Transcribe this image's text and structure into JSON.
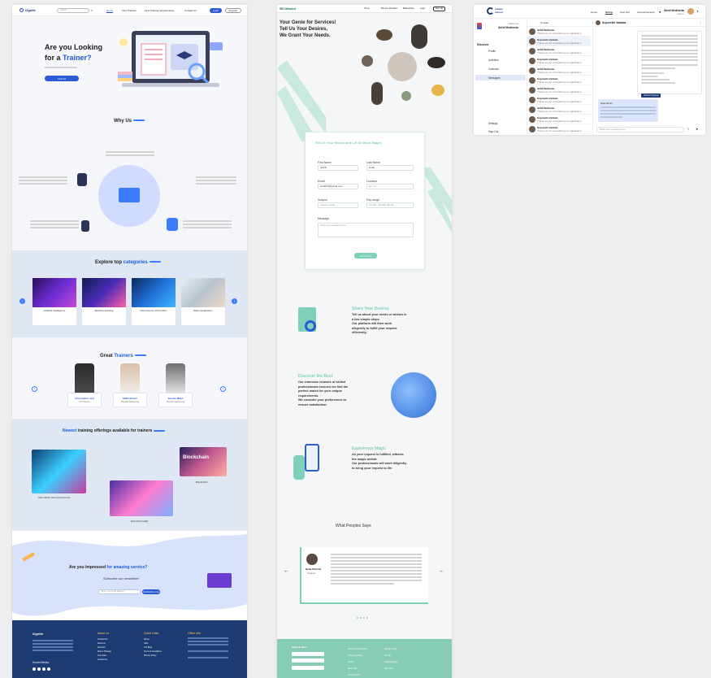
{
  "s1": {
    "header": {
      "logo": "i2gnite",
      "search_placeholder": "Search",
      "nav": [
        "Home",
        "Find Trainers",
        "Find Training Opportunities",
        "Contact Us"
      ],
      "login": "Login",
      "register": "Register"
    },
    "hero": {
      "title_a": "Are you Looking",
      "title_b": "for a ",
      "title_c": "Trainer?",
      "cta": "Find All"
    },
    "why": {
      "title": "Why Us"
    },
    "categories": {
      "title_a": "Explore top ",
      "title_b": "categories",
      "items": [
        {
          "name": "Artificial Intelligence"
        },
        {
          "name": "Machine learning"
        },
        {
          "name": "Data science Information"
        },
        {
          "name": "Data visualization"
        }
      ]
    },
    "trainers": {
      "title_a": "Great ",
      "title_b": "Trainers",
      "items": [
        {
          "name": "Christopher Jest",
          "role": "UI Trainer"
        },
        {
          "name": "Millie Brown",
          "role": "Digital Marketing"
        },
        {
          "name": "Brooke Milan",
          "role": "Digital Marketing"
        }
      ]
    },
    "offerings": {
      "title_a": "Newest",
      "title_b": " training offerings available for trainers",
      "items": [
        "Information and cybersecurity",
        "Blockchain",
        "Extended reality"
      ],
      "blockchain_image_text": "Blockchain"
    },
    "newsletter": {
      "title_a": "Are you Impressed ",
      "title_b": "for amazing service?",
      "subtitle": "Subscribe our newsletter",
      "placeholder": "Enter your email address",
      "button": "Subscribe now"
    },
    "footer": {
      "logo": "i2gnite",
      "about_title": "About us",
      "about_items": [
        "Contact Us",
        "About us",
        "Services",
        "Post a Training",
        "Our Team",
        "Contact Us"
      ],
      "quick_title": "Quick Links",
      "quick_items": [
        "Home",
        "Jobs",
        "Our Blog",
        "Terms & Conditions",
        "Privacy Policy"
      ],
      "office_title": "Office Info",
      "social": "Social Media"
    }
  },
  "s2": {
    "header": {
      "logo": "WiCitMarket",
      "nav": [
        "Home",
        "Become Providers",
        "Marketplace",
        "Login"
      ],
      "signup": "Sign Up"
    },
    "hero": {
      "line1": "Your Genie for Services!",
      "line2": "Tell Us Your Desires,",
      "line3": "We Grant Your Needs."
    },
    "form": {
      "title": "Tell Us Your Needs and Let Us Work Magic!",
      "first_name": {
        "label": "First Name",
        "value": "Aishik"
      },
      "last_name": {
        "label": "Last Name",
        "value": "Dutta"
      },
      "email": {
        "label": "Email",
        "value": "aishik01@gmail.com"
      },
      "location": {
        "label": "Location",
        "value": "Ex: xxx"
      },
      "subject": {
        "label": "Subject",
        "value": "Select a Goal"
      },
      "pay_range": {
        "label": "Pay range",
        "value": "10,000 - 20,000 /Month"
      },
      "message": {
        "label": "Message",
        "placeholder": "Write your request here..."
      },
      "submit": "Send Now"
    },
    "features": [
      {
        "title": "Share Your Desires",
        "body": [
          "Tell us about your needs or wishes in",
          "a few simple steps.",
          "Our platform will then work",
          "diligently to fulfill your request",
          "efficiently."
        ]
      },
      {
        "title": "Discover the Best",
        "body": [
          "Our extensive network of skilled",
          "professionals ensures we find the",
          "perfect match for your unique",
          "requirements.",
          "We consider your preferences to",
          "ensure satisfaction."
        ]
      },
      {
        "title": "Experience Magic",
        "body": [
          "As your request is fulfilled, witness",
          "the magic unfold.",
          "Our professionals will work diligently",
          "to bring your request to life"
        ]
      }
    ],
    "testimonials": {
      "title": "What Peoples Says",
      "name": "Neha Sharma",
      "role": "Student"
    },
    "footer": {
      "sign_up": "Sign Up Now",
      "col2": [
        "Terms of Services",
        "Privacy policy",
        "FAQs",
        "Become",
        "Contact Us"
      ],
      "col3_title": "Quick Links",
      "col3": [
        "Home",
        "Marketplace",
        "Services"
      ]
    }
  },
  "s3": {
    "header": {
      "logo_a": "unique",
      "logo_b": "school",
      "nav": [
        "Home",
        "Hiring",
        "Post Job",
        "Announcements"
      ],
      "user": "Akhil Mukheda",
      "user_role": "Admin"
    },
    "sidebar": {
      "welcome": "Welcome",
      "name": "Akhil Mukheda",
      "section": "Discover",
      "items": [
        "Profile",
        "Activities",
        "Calendar",
        "Messages"
      ],
      "settings": "Settings",
      "signout": "Sign Out"
    },
    "chat_list": {
      "filter": "Unread",
      "rows": [
        {
          "name": "Akhil Mukheda",
          "preview": "Thank you for considering my application"
        },
        {
          "name": "Supreethi Vadada",
          "preview": "Thank you for considering my application"
        },
        {
          "name": "Akhil Mukheda",
          "preview": "Thank you for considering my application"
        },
        {
          "name": "Supreethi Vadada",
          "preview": "Thank you for considering my application"
        },
        {
          "name": "Akhil Mukheda",
          "preview": "Thank you for considering my application"
        },
        {
          "name": "Supreethi Vadada",
          "preview": "Thank you for considering my application"
        },
        {
          "name": "Akhil Mukheda",
          "preview": "Thank you for considering my application"
        },
        {
          "name": "Supreethi Vadada",
          "preview": "Thank you for considering my application"
        },
        {
          "name": "Akhil Mukheda",
          "preview": "Thank you for considering my application"
        },
        {
          "name": "Supreethi Vadada",
          "preview": "Thank you for considering my application"
        },
        {
          "name": "Supreethi Vadada",
          "preview": "Thank you for considering my application"
        }
      ]
    },
    "conversation": {
      "name": "Supreethi Vadada",
      "bubble_action": "Submit Proposal",
      "reply_greeting": "Dear Admin,",
      "input_placeholder": "Write your message here..."
    }
  }
}
